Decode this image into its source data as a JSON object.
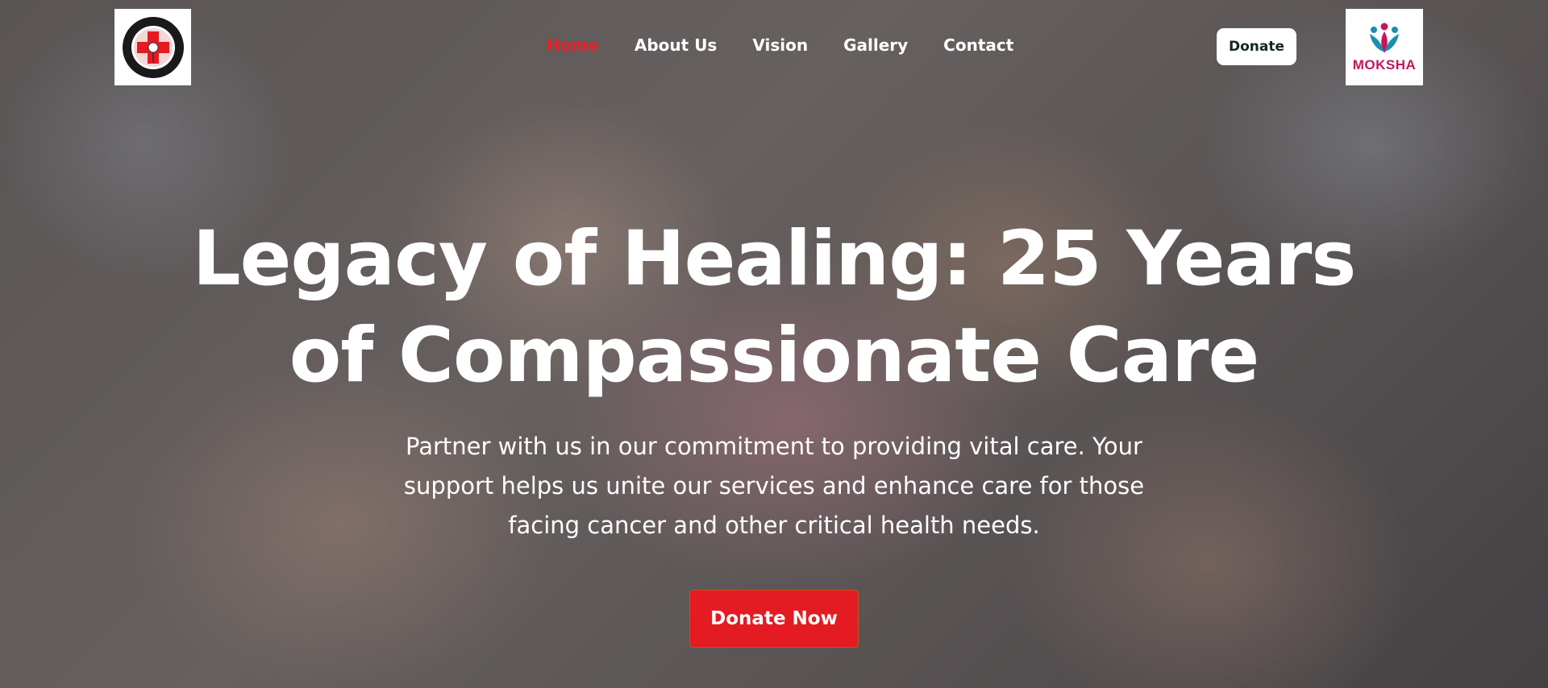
{
  "header": {
    "left_logo_icon": "red-cross-cancer-centre-logo",
    "nav": {
      "home": "Home",
      "about": "About Us",
      "vision": "Vision",
      "gallery": "Gallery",
      "contact": "Contact"
    },
    "donate_label": "Donate",
    "right_logo_text": "MOKSHA"
  },
  "hero": {
    "title": "Legacy of Healing: 25 Years of Compassionate Care",
    "subtitle": "Partner with us in our commitment to providing vital care. Your support helps us unite our services and enhance care for those facing cancer and other critical health needs.",
    "cta_label": "Donate Now"
  },
  "colors": {
    "accent_red": "#e41b23",
    "nav_active": "#e8202a",
    "brand_pink": "#c2185b",
    "brand_teal": "#1a8fb0"
  }
}
